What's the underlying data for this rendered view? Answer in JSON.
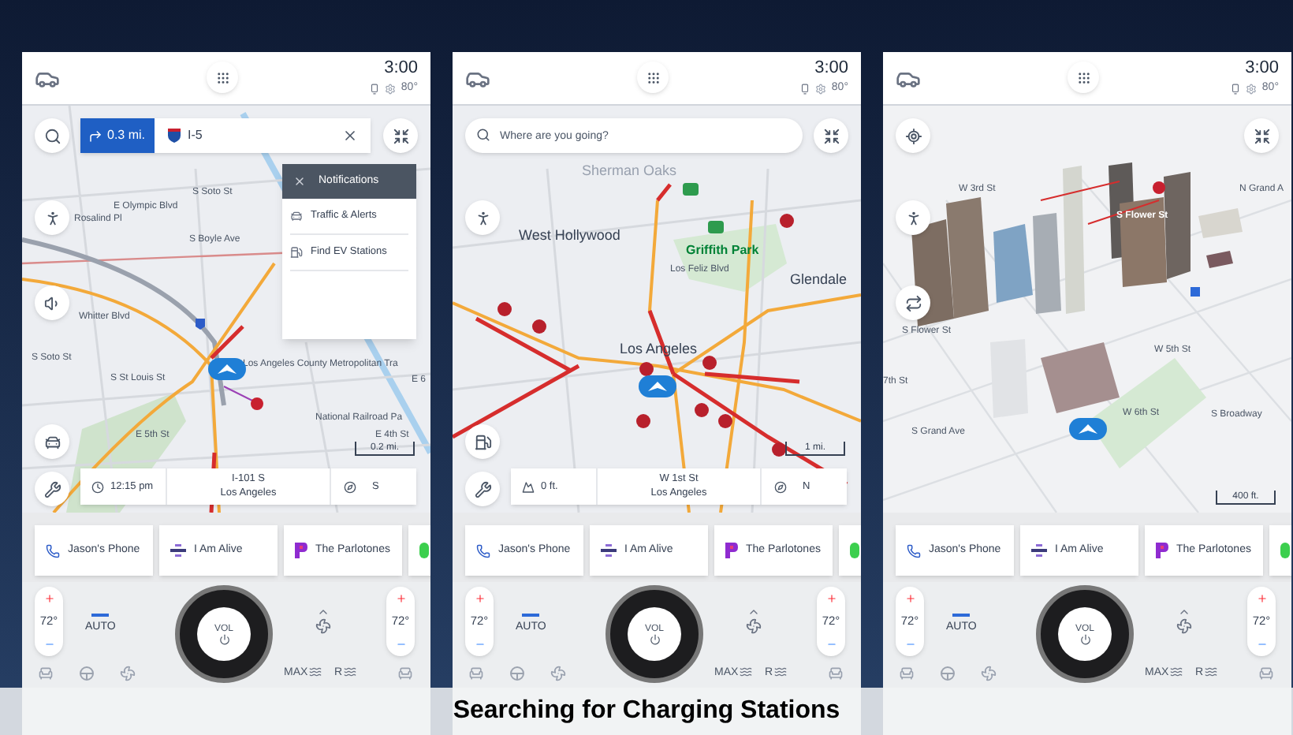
{
  "screens": [
    {
      "status": {
        "time": "3:00",
        "temperature": "80°"
      },
      "route": {
        "distance": "0.3 mi.",
        "road": "I-5"
      },
      "notifications": {
        "title": "Notifications",
        "items": [
          {
            "kind": "traffic",
            "label": "Traffic & Alerts"
          },
          {
            "kind": "ev",
            "label": "Find EV Stations"
          }
        ]
      },
      "side_buttons": [
        {
          "kind": "search"
        },
        {
          "kind": "person"
        },
        {
          "kind": "speaker"
        },
        {
          "kind": "traffic"
        },
        {
          "kind": "tools"
        }
      ],
      "map": {
        "kind": "street",
        "scale": "0.2 mi.",
        "labels": [
          {
            "text": "S Soto St",
            "kind": "street"
          },
          {
            "text": "E Olympic Blvd",
            "kind": "street"
          },
          {
            "text": "Rosalind Pl",
            "kind": "street"
          },
          {
            "text": "S Boyle Ave",
            "kind": "street"
          },
          {
            "text": "Whitter Blvd",
            "kind": "street"
          },
          {
            "text": "S Soto St",
            "kind": "street"
          },
          {
            "text": "S St Louis St",
            "kind": "street"
          },
          {
            "text": "Los Angeles County Metropolitan Tra",
            "kind": "street"
          },
          {
            "text": "E 6",
            "kind": "street"
          },
          {
            "text": "National Railroad Pa",
            "kind": "street"
          },
          {
            "text": "E 4th St",
            "kind": "street"
          },
          {
            "text": "E 5th St",
            "kind": "street"
          }
        ]
      },
      "trip_info": {
        "kind": "time",
        "value": "12:15 pm",
        "street": "I-101 S",
        "city": "Los Angeles",
        "heading": "S"
      },
      "media": [
        {
          "kind": "phone",
          "label": "Jason's Phone"
        },
        {
          "kind": "radio",
          "label": "I Am Alive"
        },
        {
          "kind": "music",
          "label": "The Parlotones"
        },
        {
          "kind": "app"
        }
      ],
      "climate": {
        "left_temp": "72°",
        "fan": "AUTO",
        "knob": "VOL",
        "right_temp": "72°"
      },
      "bottom_controls": [
        {
          "kind": "seat"
        },
        {
          "kind": "steering"
        },
        {
          "kind": "fan"
        },
        {
          "kind": "front-defrost",
          "label": "MAX"
        },
        {
          "kind": "rear-defrost",
          "label": "R"
        },
        {
          "kind": "seat"
        }
      ]
    },
    {
      "status": {
        "time": "3:00",
        "temperature": "80°"
      },
      "search": {
        "placeholder": "Where are you going?"
      },
      "side_buttons": [
        {
          "kind": "person"
        },
        {
          "kind": "ev"
        },
        {
          "kind": "tools"
        }
      ],
      "map": {
        "kind": "city",
        "scale": "1 mi.",
        "labels": [
          {
            "text": "Sherman Oaks",
            "kind": "faded"
          },
          {
            "text": "West Hollywood",
            "kind": "area"
          },
          {
            "text": "Griffith Park",
            "kind": "park"
          },
          {
            "text": "Los Feliz Blvd",
            "kind": "street"
          },
          {
            "text": "Glendale",
            "kind": "area"
          },
          {
            "text": "Los Angeles",
            "kind": "area"
          }
        ]
      },
      "trip_info": {
        "kind": "elevation",
        "value": "0 ft.",
        "street": "W 1st St",
        "city": "Los Angeles",
        "heading": "N"
      },
      "media": [
        {
          "kind": "phone",
          "label": "Jason's Phone"
        },
        {
          "kind": "radio",
          "label": "I Am Alive"
        },
        {
          "kind": "music",
          "label": "The Parlotones"
        },
        {
          "kind": "app"
        }
      ],
      "climate": {
        "left_temp": "72°",
        "fan": "AUTO",
        "knob": "VOL",
        "right_temp": "72°"
      },
      "bottom_controls": [
        {
          "kind": "seat"
        },
        {
          "kind": "steering"
        },
        {
          "kind": "fan"
        },
        {
          "kind": "front-defrost",
          "label": "MAX"
        },
        {
          "kind": "rear-defrost",
          "label": "R"
        },
        {
          "kind": "seat"
        }
      ]
    },
    {
      "status": {
        "time": "3:00",
        "temperature": "80°"
      },
      "side_buttons": [
        {
          "kind": "locate"
        },
        {
          "kind": "person"
        },
        {
          "kind": "swap"
        }
      ],
      "map": {
        "kind": "perspective",
        "scale": "400 ft.",
        "labels": [
          {
            "text": "W 3rd St",
            "kind": "street"
          },
          {
            "text": "N Grand A",
            "kind": "street"
          },
          {
            "text": "S Flower St",
            "kind": "building"
          },
          {
            "text": "S Flower St",
            "kind": "street"
          },
          {
            "text": "W 5th St",
            "kind": "street"
          },
          {
            "text": "7th St",
            "kind": "street"
          },
          {
            "text": "W 6th St",
            "kind": "street"
          },
          {
            "text": "S Broadway",
            "kind": "street"
          },
          {
            "text": "S Grand Ave",
            "kind": "street"
          }
        ]
      },
      "media": [
        {
          "kind": "phone",
          "label": "Jason's Phone"
        },
        {
          "kind": "radio",
          "label": "I Am Alive"
        },
        {
          "kind": "music",
          "label": "The Parlotones"
        },
        {
          "kind": "app"
        }
      ],
      "climate": {
        "left_temp": "72°",
        "fan": "AUTO",
        "knob": "VOL",
        "right_temp": "72°"
      },
      "bottom_controls": [
        {
          "kind": "seat"
        },
        {
          "kind": "steering"
        },
        {
          "kind": "fan"
        },
        {
          "kind": "front-defrost",
          "label": "MAX"
        },
        {
          "kind": "rear-defrost",
          "label": "R"
        },
        {
          "kind": "seat"
        }
      ]
    }
  ],
  "caption": "Searching for Charging Stations"
}
